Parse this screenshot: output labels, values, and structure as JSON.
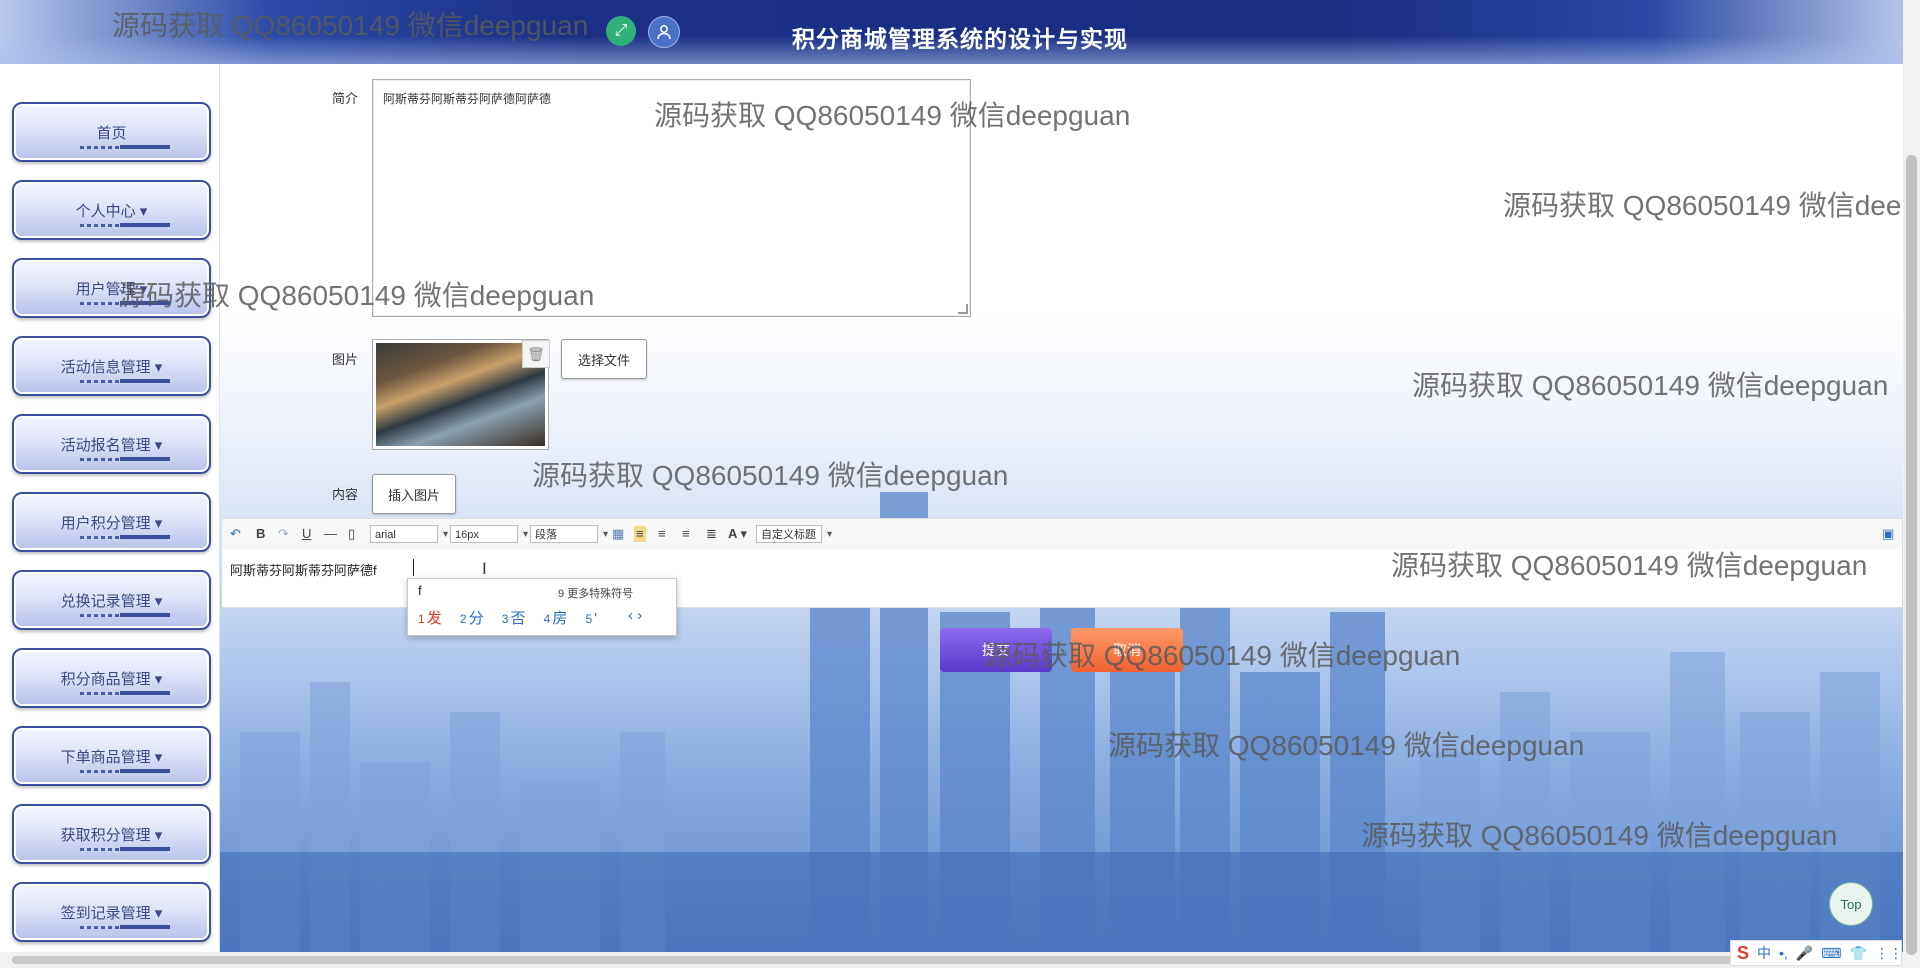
{
  "header": {
    "title": "积分商城管理系统的设计与实现",
    "icons": [
      "expand-icon",
      "user-icon"
    ]
  },
  "sidebar": {
    "items": [
      {
        "label": "首页"
      },
      {
        "label": "个人中心 ▾"
      },
      {
        "label": "用户管理 ▾"
      },
      {
        "label": "活动信息管理 ▾"
      },
      {
        "label": "活动报名管理 ▾"
      },
      {
        "label": "用户积分管理 ▾"
      },
      {
        "label": "兑换记录管理 ▾"
      },
      {
        "label": "积分商品管理 ▾"
      },
      {
        "label": "下单商品管理 ▾"
      },
      {
        "label": "获取积分管理 ▾"
      },
      {
        "label": "签到记录管理 ▾"
      }
    ]
  },
  "form": {
    "intro_label": "简介",
    "intro_value": "阿斯蒂芬阿斯蒂芬阿萨德阿萨德",
    "image_label": "图片",
    "choose_file_label": "选择文件",
    "content_label": "内容",
    "insert_image_label": "插入图片"
  },
  "editor": {
    "toolbar": {
      "font_family": "arial",
      "font_size": "16px",
      "paragraph": "段落",
      "custom_title": "自定义标题"
    },
    "text": "阿斯蒂芬阿斯蒂芬阿萨德f"
  },
  "ime": {
    "composition": "f",
    "more_symbols": "9 更多特殊符号",
    "candidates": [
      {
        "num": "1",
        "text": "发"
      },
      {
        "num": "2",
        "text": "分"
      },
      {
        "num": "3",
        "text": "否"
      },
      {
        "num": "4",
        "text": "房"
      },
      {
        "num": "5",
        "text": "'"
      }
    ],
    "nav": "‹ ›"
  },
  "buttons": {
    "submit": "提交",
    "cancel": "取消",
    "top": "Top"
  },
  "tray": {
    "items": [
      "S",
      "中",
      "•,",
      "🎤",
      "⌨",
      "👕",
      "⋮⋮"
    ]
  },
  "watermark": "源码获取 QQ86050149 微信deepguan",
  "colors": {
    "header": "#1b2e84",
    "nav_border": "#3e4fa0",
    "submit": "#6a48d8",
    "cancel": "#f06030"
  }
}
